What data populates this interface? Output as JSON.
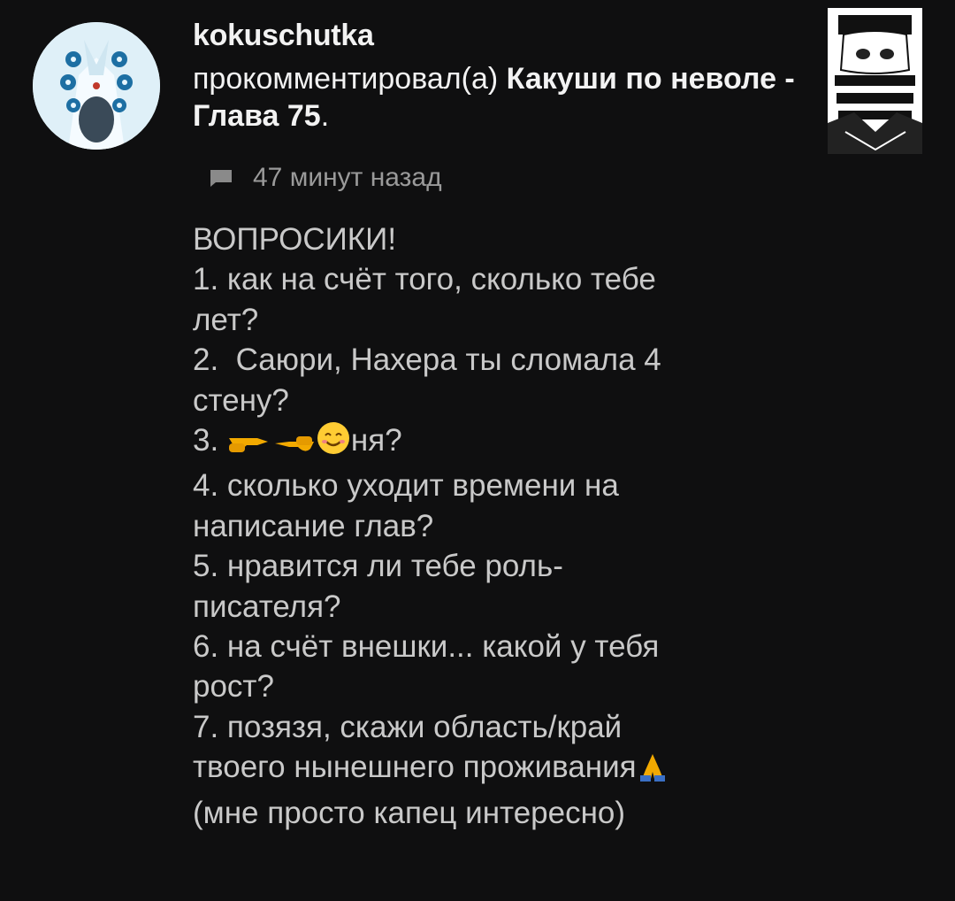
{
  "comment": {
    "username": "kokuschutka",
    "action": "прокомментировал(а)",
    "chapter_title": "Какуши по неволе - Глава 75",
    "chapter_suffix": ".",
    "time": "47 минут назад",
    "avatar_icon": "multi-eye-avatar",
    "thumbnail_icon": "manga-character-thumbnail",
    "comment_icon": "comment-bubble-icon"
  },
  "body": {
    "heading": "ВОПРОСИКИ!",
    "q1": "1. как на счёт того, сколько тебе\nлет?",
    "q2": "2.  Саюри, Нахера ты сломала 4\nстену?",
    "q3_prefix": "3. ",
    "q3_suffix": "ня?",
    "q4": "4. сколько уходит времени на\nнаписание глав?",
    "q5": "5. нравится ли тебе роль-\nписателя?",
    "q6": "6. на счёт внешки... какой у тебя\nрост?",
    "q7_line1": "7. позязя, скажи область/край",
    "q7_line2": "твоего нынешнего проживания",
    "q7_line3": "(мне просто капец интересно)",
    "q3_emoji": [
      "pointing-right-hand",
      "pointing-left-hand",
      "smiling-face"
    ],
    "q7_emoji": "folded-hands"
  }
}
